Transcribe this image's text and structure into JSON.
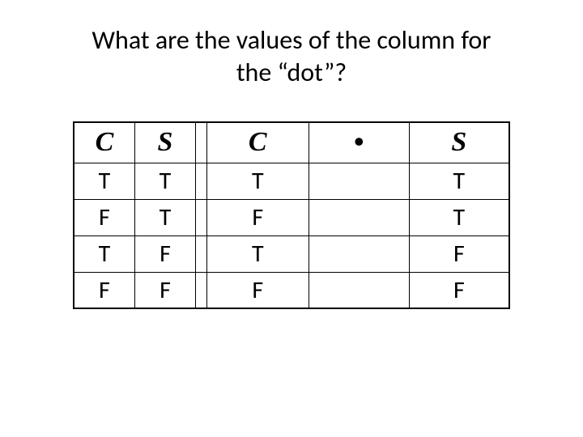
{
  "title": "What are the values of the column for the “dot”?",
  "headers": {
    "h1": "C",
    "h2": "S",
    "h4": "C",
    "h5": "•",
    "h6": "S"
  },
  "rows": [
    {
      "c1": "T",
      "c2": "T",
      "c4": "T",
      "c5": "",
      "c6": "T"
    },
    {
      "c1": "F",
      "c2": "T",
      "c4": "F",
      "c5": "",
      "c6": "T"
    },
    {
      "c1": "T",
      "c2": "F",
      "c4": "T",
      "c5": "",
      "c6": "F"
    },
    {
      "c1": "F",
      "c2": "F",
      "c4": "F",
      "c5": "",
      "c6": "F"
    }
  ]
}
